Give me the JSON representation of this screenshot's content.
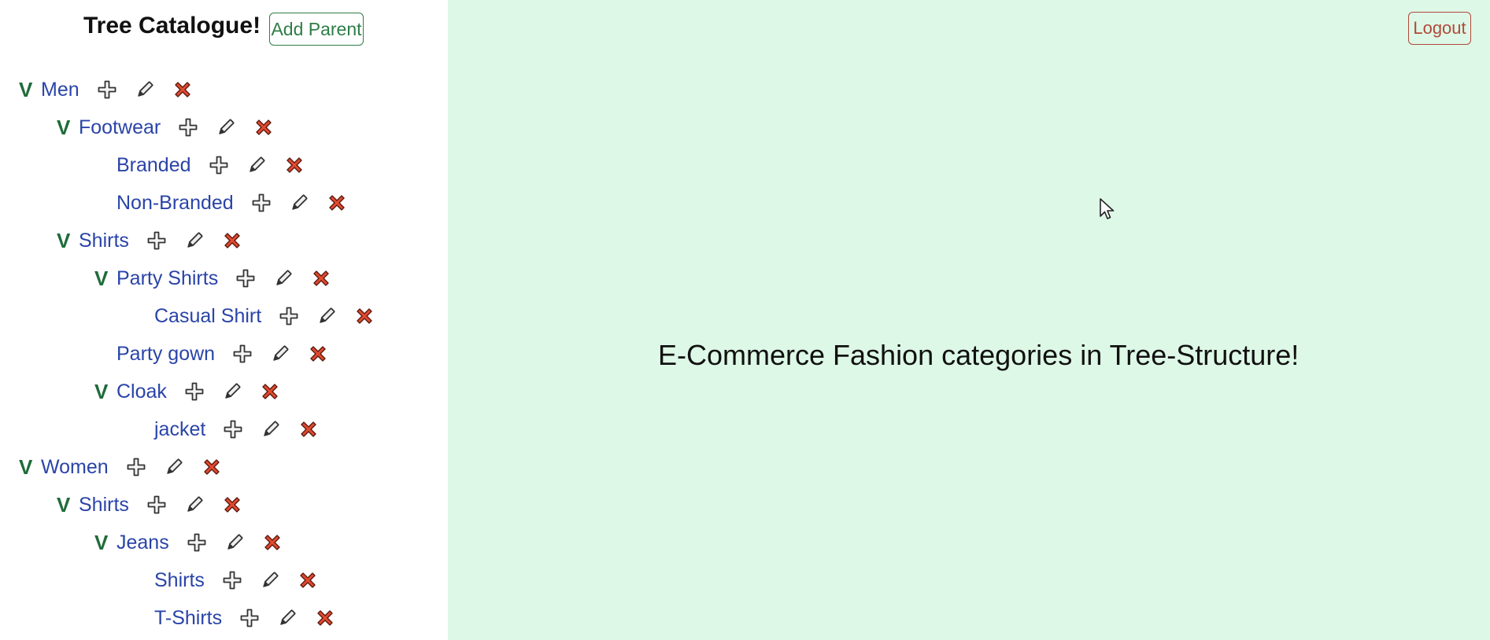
{
  "sidebar": {
    "title": "Tree Catalogue!",
    "add_parent_label": "Add Parent",
    "toggle_symbol": "V",
    "action_icons": [
      "plus-icon",
      "pencil-icon",
      "close-icon"
    ],
    "tree": [
      {
        "label": "Men",
        "depth": 0,
        "expanded": true
      },
      {
        "label": "Footwear",
        "depth": 1,
        "expanded": true
      },
      {
        "label": "Branded",
        "depth": 2,
        "expanded": false
      },
      {
        "label": "Non-Branded",
        "depth": 2,
        "expanded": false
      },
      {
        "label": "Shirts",
        "depth": 1,
        "expanded": true
      },
      {
        "label": "Party Shirts",
        "depth": 2,
        "expanded": true
      },
      {
        "label": "Casual Shirt",
        "depth": 3,
        "expanded": false
      },
      {
        "label": "Party gown",
        "depth": 2,
        "expanded": false
      },
      {
        "label": "Cloak",
        "depth": 2,
        "expanded": true
      },
      {
        "label": "jacket",
        "depth": 3,
        "expanded": false
      },
      {
        "label": "Women",
        "depth": 0,
        "expanded": true
      },
      {
        "label": "Shirts",
        "depth": 1,
        "expanded": true
      },
      {
        "label": "Jeans",
        "depth": 2,
        "expanded": true
      },
      {
        "label": "Shirts",
        "depth": 3,
        "expanded": false
      },
      {
        "label": "T-Shirts",
        "depth": 3,
        "expanded": false
      }
    ]
  },
  "main": {
    "logout_label": "Logout",
    "heading": "E-Commerce Fashion categories in Tree-Structure!"
  },
  "colors": {
    "main_background": "#ddf8e6",
    "node_label": "#2a44a8",
    "toggle": "#1f6b3a",
    "add_parent": "#2e7d47",
    "logout": "#b1493a",
    "delete_icon": "#e24a2f"
  }
}
